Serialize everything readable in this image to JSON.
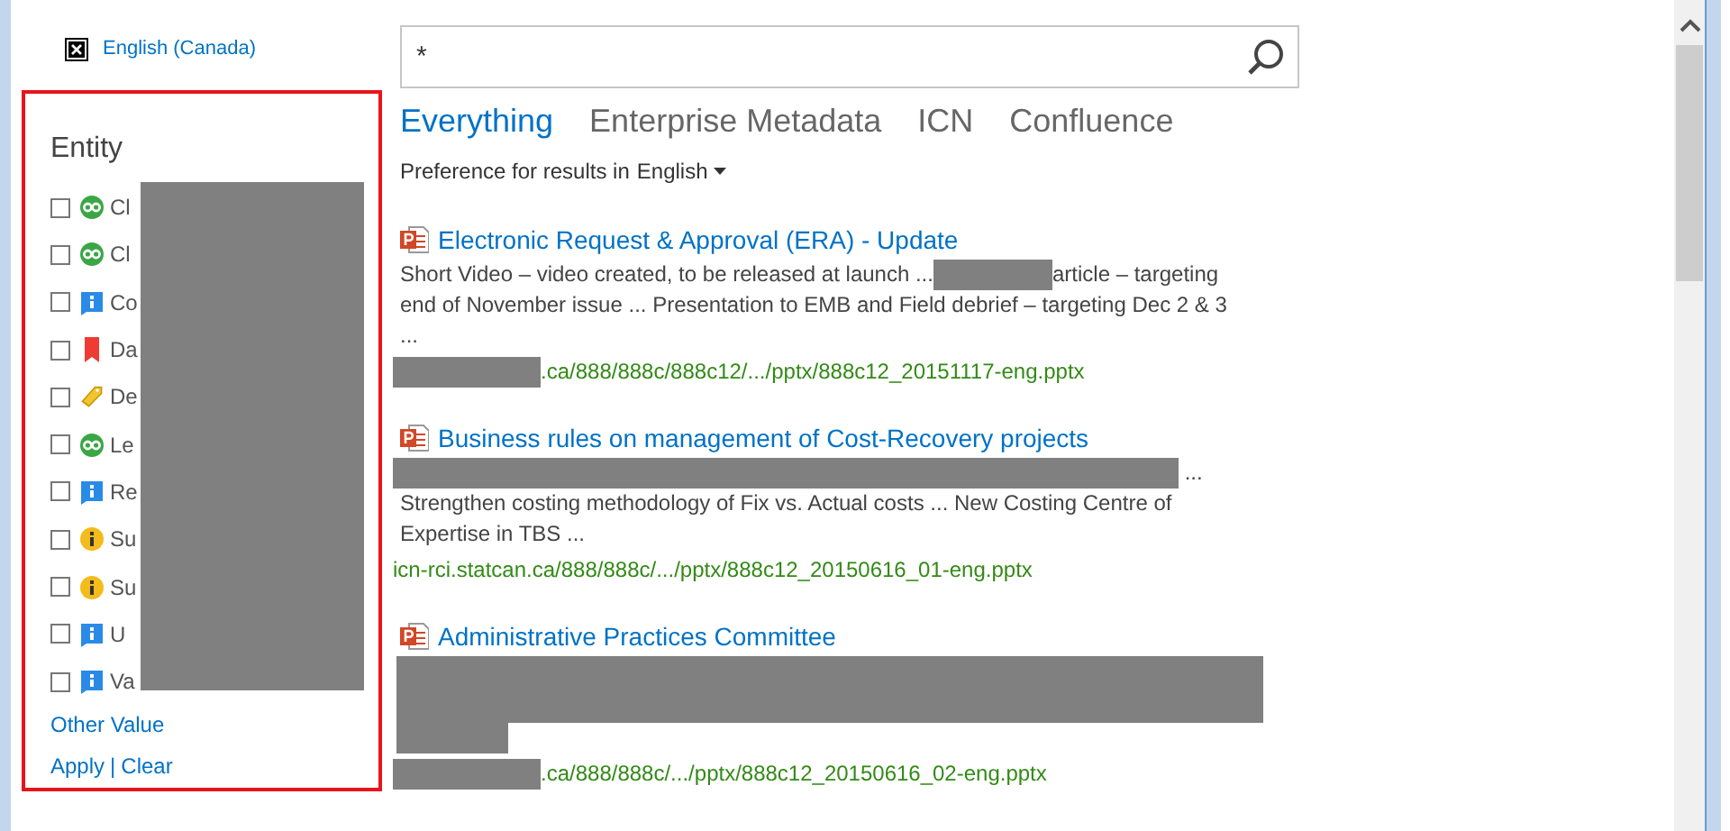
{
  "language_link": "English (Canada)",
  "refiner": {
    "title": "Entity",
    "items": [
      {
        "label": "Cl",
        "kind": "link",
        "checked": false
      },
      {
        "label": "Cl",
        "kind": "link",
        "checked": false
      },
      {
        "label": "Co",
        "kind": "info",
        "checked": false
      },
      {
        "label": "Da",
        "kind": "bookmark",
        "checked": false
      },
      {
        "label": "De",
        "kind": "tag",
        "checked": false
      },
      {
        "label": "Le",
        "kind": "link",
        "checked": false
      },
      {
        "label": "Re",
        "kind": "info",
        "checked": false
      },
      {
        "label": "Su",
        "kind": "notice",
        "checked": false
      },
      {
        "label": "Su",
        "kind": "notice",
        "checked": false
      },
      {
        "label": "U",
        "kind": "info",
        "checked": false
      },
      {
        "label": "Va",
        "kind": "info",
        "checked": false
      }
    ],
    "other_value": "Other Value",
    "apply": "Apply",
    "separator": "|",
    "clear": "Clear"
  },
  "search": {
    "value": "*"
  },
  "verticals": [
    {
      "label": "Everything",
      "selected": true
    },
    {
      "label": "Enterprise Metadata",
      "selected": false
    },
    {
      "label": "ICN",
      "selected": false
    },
    {
      "label": "Confluence",
      "selected": false
    }
  ],
  "preference": {
    "text": "Preference for results in",
    "language": "English"
  },
  "results": [
    {
      "title": "Electronic Request & Approval (ERA) - Update",
      "snippet": [
        {
          "kind": "text",
          "text": "Short Video – video created, to be released at launch ..."
        },
        {
          "kind": "redacted_word"
        },
        {
          "kind": "text",
          "text": "article – targeting"
        },
        {
          "kind": "break"
        },
        {
          "kind": "text",
          "text": "end of November issue ... Presentation to EMB and Field debrief – targeting Dec 2 & 3"
        },
        {
          "kind": "break"
        },
        {
          "kind": "text",
          "text": "..."
        }
      ],
      "url": [
        {
          "kind": "redacted_word"
        },
        {
          "kind": "text",
          "text": ".ca/888/888c/888c12/.../pptx/888c12_20151117-eng.pptx"
        }
      ]
    },
    {
      "title": "Business rules on management of Cost-Recovery projects",
      "snippet": [
        {
          "kind": "redacted_line"
        },
        {
          "kind": "text",
          "text": " ..."
        },
        {
          "kind": "break"
        },
        {
          "kind": "text",
          "text": "Strengthen costing methodology of Fix vs. Actual costs ... New Costing Centre of"
        },
        {
          "kind": "break"
        },
        {
          "kind": "text",
          "text": "Expertise in TBS ..."
        }
      ],
      "url": [
        {
          "kind": "text",
          "text": "icn-rci.statcan.ca/888/888c/.../pptx/888c12_20150616_01-eng.pptx"
        }
      ]
    },
    {
      "title": "Administrative Practices Committee",
      "snippet": [
        {
          "kind": "redacted_block"
        }
      ],
      "url": [
        {
          "kind": "redacted_word"
        },
        {
          "kind": "text",
          "text": ".ca/888/888c/.../pptx/888c12_20150616_02-eng.pptx"
        }
      ]
    }
  ]
}
